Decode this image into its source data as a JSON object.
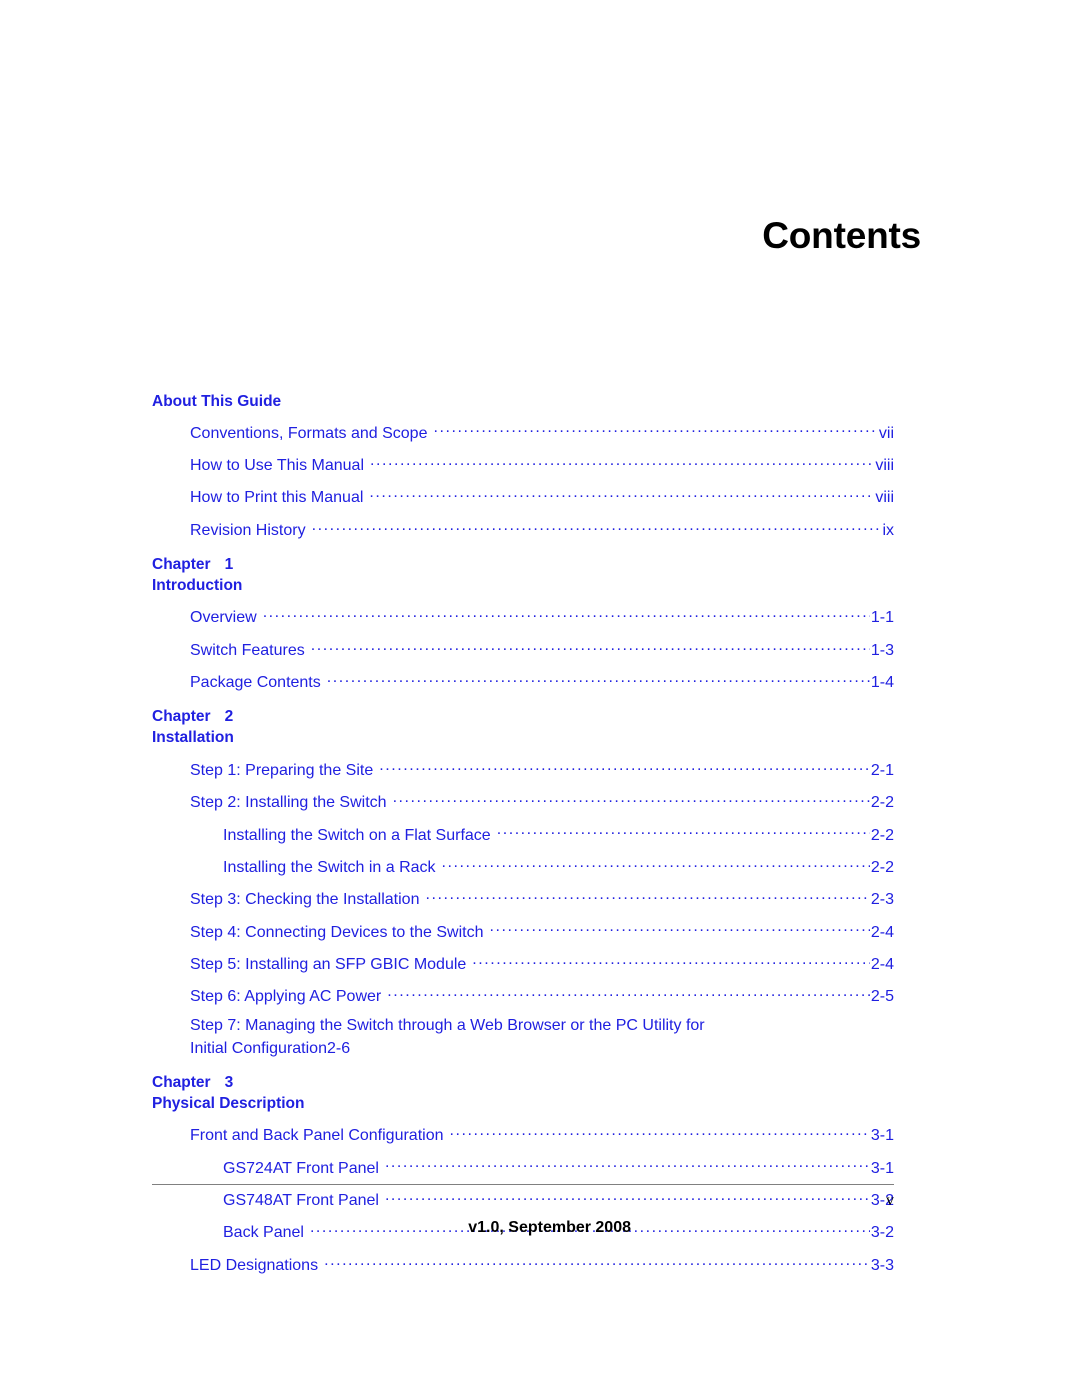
{
  "document": {
    "title": "Contents",
    "page_number": "v",
    "version_line": "v1.0, September 2008"
  },
  "sections": [
    {
      "kind": "section",
      "heading": "About This Guide",
      "entries": [
        {
          "label": "Conventions, Formats and Scope",
          "page": "vii",
          "level": 1
        },
        {
          "label": "How to Use This Manual",
          "page": "viii",
          "level": 1
        },
        {
          "label": "How to Print this Manual",
          "page": "viii",
          "level": 1
        },
        {
          "label": "Revision History",
          "page": "ix",
          "level": 1
        }
      ]
    },
    {
      "kind": "chapter",
      "chapter_word": "Chapter",
      "chapter_number": "1",
      "chapter_title": "Introduction",
      "entries": [
        {
          "label": "Overview",
          "page": "1-1",
          "level": 1
        },
        {
          "label": "Switch Features",
          "page": "1-3",
          "level": 1
        },
        {
          "label": "Package Contents",
          "page": "1-4",
          "level": 1
        }
      ]
    },
    {
      "kind": "chapter",
      "chapter_word": "Chapter",
      "chapter_number": "2",
      "chapter_title": "Installation",
      "entries": [
        {
          "label": "Step 1: Preparing the Site",
          "page": "2-1",
          "level": 1
        },
        {
          "label": "Step 2: Installing the Switch",
          "page": "2-2",
          "level": 1
        },
        {
          "label": "Installing the Switch on a Flat Surface",
          "page": "2-2",
          "level": 2
        },
        {
          "label": "Installing the Switch in a Rack",
          "page": "2-2",
          "level": 2
        },
        {
          "label": "Step 3: Checking the Installation",
          "page": "2-3",
          "level": 1
        },
        {
          "label": "Step 4: Connecting Devices to the Switch",
          "page": "2-4",
          "level": 1
        },
        {
          "label": "Step 5: Installing an SFP GBIC Module",
          "page": "2-4",
          "level": 1
        },
        {
          "label": "Step 6: Applying AC Power",
          "page": "2-5",
          "level": 1
        },
        {
          "label": "Step 7: Managing the Switch through a Web Browser or the PC Utility for",
          "label_line2": "Initial Configuration",
          "page": "2-6",
          "level": 1,
          "wrapped": true
        }
      ]
    },
    {
      "kind": "chapter",
      "chapter_word": "Chapter",
      "chapter_number": "3",
      "chapter_title": "Physical Description",
      "entries": [
        {
          "label": "Front and Back Panel Configuration",
          "page": "3-1",
          "level": 1
        },
        {
          "label": "GS724AT Front Panel",
          "page": "3-1",
          "level": 2
        },
        {
          "label": "GS748AT Front Panel",
          "page": "3-2",
          "level": 2
        },
        {
          "label": "Back Panel",
          "page": "3-2",
          "level": 2
        },
        {
          "label": "LED Designations",
          "page": "3-3",
          "level": 1
        }
      ]
    }
  ],
  "colors": {
    "link_blue": "#2020E0",
    "text_black": "#000000",
    "rule_gray": "#808080"
  }
}
